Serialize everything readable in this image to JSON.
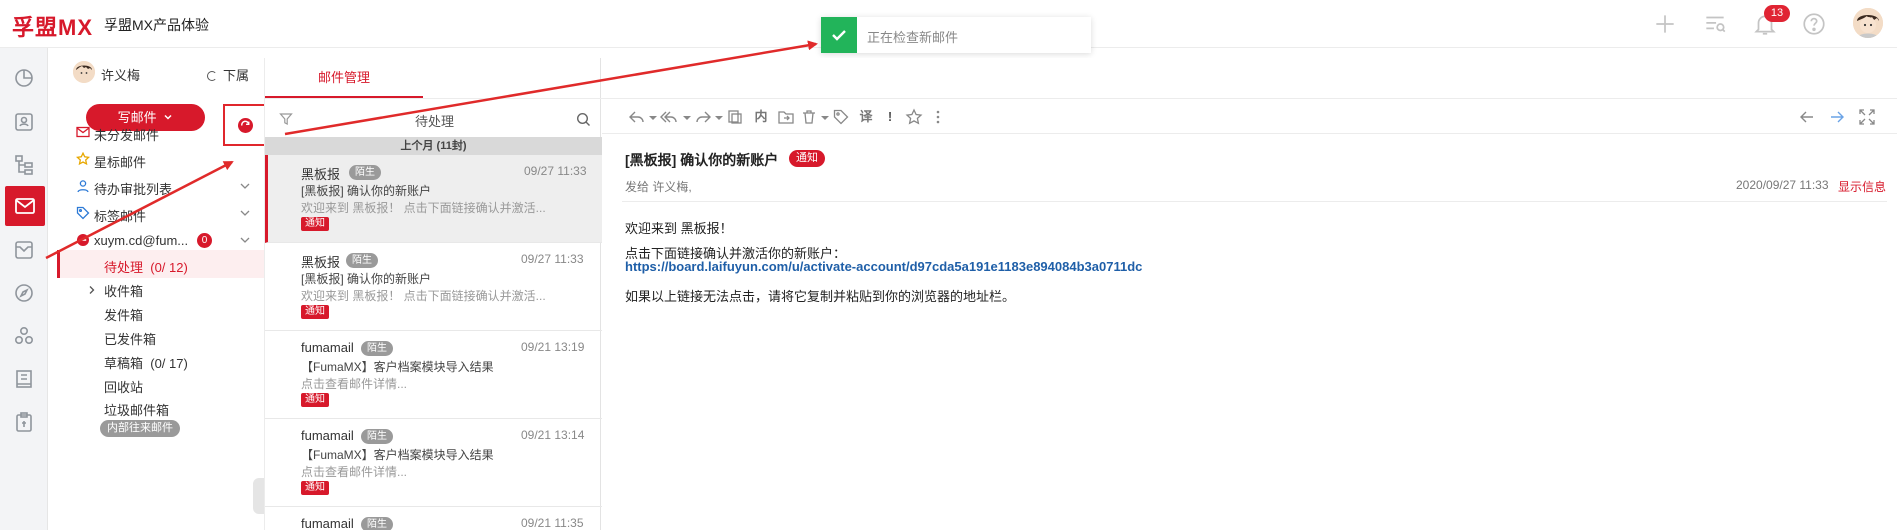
{
  "app": {
    "logo": "孚盟MX",
    "title": "孚盟MX产品体验"
  },
  "header": {
    "notification_count": "13"
  },
  "toast": {
    "text": "正在检查新邮件"
  },
  "colors": {
    "brand": "#d7192b",
    "success": "#22b45a"
  },
  "rail": {
    "items": [
      {
        "icon": "pie-chart-icon"
      },
      {
        "icon": "contact-card-icon"
      },
      {
        "icon": "org-tree-icon"
      },
      {
        "icon": "mail-icon",
        "active": true
      },
      {
        "icon": "inbox-tray-icon"
      },
      {
        "icon": "compass-icon"
      },
      {
        "icon": "circles-icon"
      },
      {
        "icon": "book-icon"
      },
      {
        "icon": "clipboard-icon"
      }
    ]
  },
  "folders": {
    "user": "许义梅",
    "sync_label": "下属",
    "write_button": "写邮件",
    "items": [
      {
        "label": "未分发邮件",
        "icon": "mail-outline-icon"
      },
      {
        "label": "星标邮件",
        "icon": "star-icon"
      },
      {
        "label": "待办审批列表",
        "icon": "user-icon"
      },
      {
        "label": "标签邮件",
        "icon": "tag-icon"
      },
      {
        "label": "xuym.cd@fum...",
        "icon": "minus-circle-icon",
        "badge": "0"
      }
    ],
    "sub": {
      "pending": "待处理",
      "pending_count": "(0/ 12)",
      "inbox": "收件箱",
      "outbox": "发件箱",
      "sent": "已发件箱",
      "drafts": "草稿箱",
      "drafts_count": "(0/ 17)",
      "recycle": "回收站",
      "junk": "垃圾邮件箱",
      "internal": "内部往来邮件"
    }
  },
  "list": {
    "tab": "邮件管理",
    "filter_label": "待处理",
    "group_header": "上个月 (11封)",
    "mails": [
      {
        "sender": "黑板报",
        "tag": "陌生",
        "date": "09/27 11:33",
        "subject": "[黑板报] 确认你的新账户",
        "preview": "欢迎来到 黑板报！  点击下面链接确认并激活...",
        "label": "通知"
      },
      {
        "sender": "黑板报",
        "tag": "陌生",
        "date": "09/27 11:33",
        "subject": "[黑板报] 确认你的新账户",
        "preview": "欢迎来到 黑板报！  点击下面链接确认并激活...",
        "label": "通知"
      },
      {
        "sender": "fumamail",
        "tag": "陌生",
        "date": "09/21 13:19",
        "subject": "【FumaMX】客户档案模块导入结果",
        "preview": "点击查看邮件详情...",
        "label": "通知"
      },
      {
        "sender": "fumamail",
        "tag": "陌生",
        "date": "09/21 13:14",
        "subject": "【FumaMX】客户档案模块导入结果",
        "preview": "点击查看邮件详情...",
        "label": "通知"
      },
      {
        "sender": "fumamail",
        "tag": "陌生",
        "date": "09/21 11:35"
      }
    ]
  },
  "toolbar": {
    "translate_label": "译",
    "inline_label": "内",
    "important_label": "!"
  },
  "message": {
    "subject": "[黑板报] 确认你的新账户",
    "label": "通知",
    "meta": "发给  许义梅,",
    "date": "2020/09/27 11:33",
    "show_info": "显示信息",
    "body": {
      "greeting": "欢迎来到 黑板报！",
      "instruction": "点击下面链接确认并激活你的新账户：",
      "link": "https://board.laifuyun.com/u/activate-account/d97cda5a191e1183e894084b3a0711dc",
      "fallback": "如果以上链接无法点击，请将它复制并粘贴到你的浏览器的地址栏。"
    }
  }
}
